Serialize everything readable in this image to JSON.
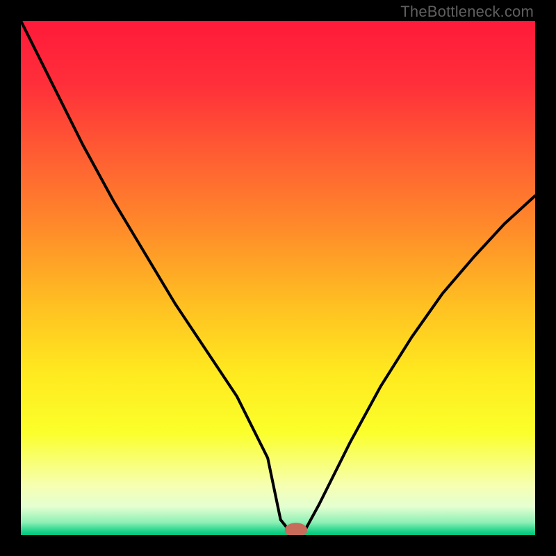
{
  "watermark": "TheBottleneck.com",
  "chart_data": {
    "type": "line",
    "title": "",
    "xlabel": "",
    "ylabel": "",
    "xlim": [
      0,
      100
    ],
    "ylim": [
      0,
      100
    ],
    "series": [
      {
        "name": "curve",
        "x": [
          0,
          6,
          12,
          18,
          24,
          30,
          36,
          42,
          48,
          50.5,
          52.5,
          55,
          58,
          64,
          70,
          76,
          82,
          88,
          94,
          100
        ],
        "y": [
          100,
          88,
          76,
          65,
          55,
          45,
          36,
          27,
          15,
          3,
          0.5,
          0.5,
          6,
          18,
          29,
          38.5,
          47,
          54,
          60.5,
          66
        ]
      }
    ],
    "marker": {
      "x": 53.5,
      "y": 1.0,
      "rx": 2.2,
      "ry": 1.4,
      "color": "#c76b5a"
    },
    "gradient": {
      "stops": [
        {
          "offset": 0.0,
          "color": "#ff1a3a"
        },
        {
          "offset": 0.12,
          "color": "#ff2e3a"
        },
        {
          "offset": 0.25,
          "color": "#ff5a33"
        },
        {
          "offset": 0.4,
          "color": "#ff8a2a"
        },
        {
          "offset": 0.55,
          "color": "#ffbf22"
        },
        {
          "offset": 0.68,
          "color": "#ffe81f"
        },
        {
          "offset": 0.8,
          "color": "#fbff2a"
        },
        {
          "offset": 0.905,
          "color": "#f6ffb3"
        },
        {
          "offset": 0.945,
          "color": "#e4ffd1"
        },
        {
          "offset": 0.975,
          "color": "#8ef0b6"
        },
        {
          "offset": 0.992,
          "color": "#1fd48a"
        },
        {
          "offset": 1.0,
          "color": "#00c37a"
        }
      ]
    }
  }
}
